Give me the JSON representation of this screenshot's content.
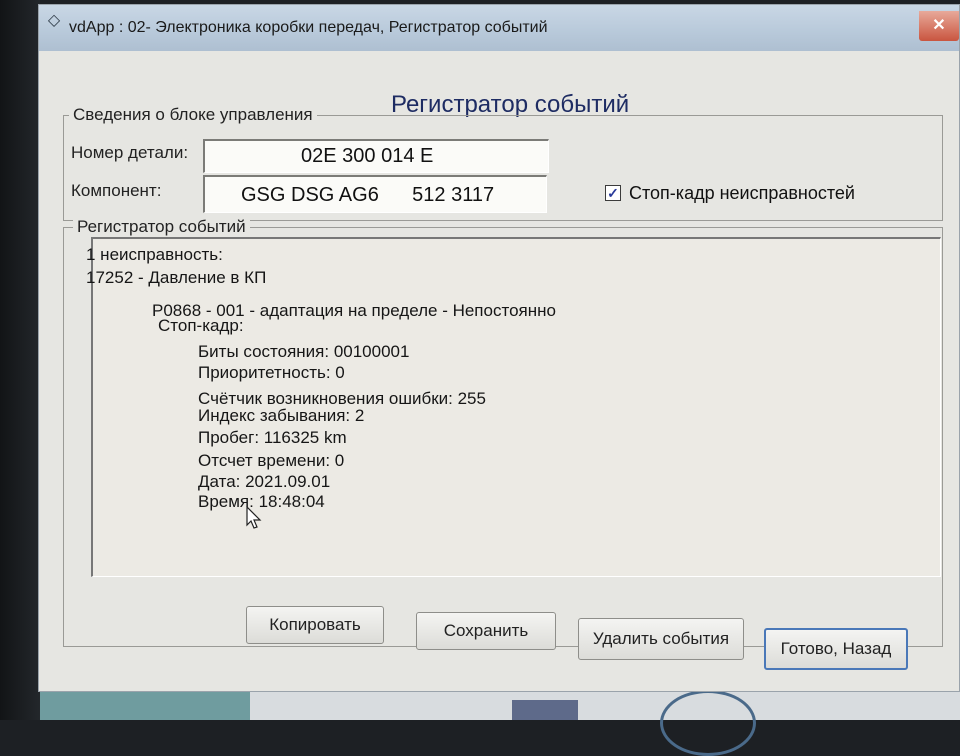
{
  "window": {
    "title": "vdApp : 02- Электроника коробки передач,  Регистратор событий",
    "close_glyph": "✕",
    "app_icon_glyph": "◇"
  },
  "dialog": {
    "title": "Регистратор событий"
  },
  "control_unit": {
    "legend": "Сведения о блоке управления",
    "part_number_label": "Номер детали:",
    "part_number_value": "02E 300 014 E",
    "component_label": "Компонент:",
    "component_value": "GSG DSG AG6      512 3117",
    "freeze_frame_checkbox_label": "Стоп-кадр неисправностей",
    "freeze_frame_checked": true
  },
  "event_log": {
    "legend": "Регистратор событий",
    "lines": [
      "1 неисправность:",
      "17252 - Давление в КП",
      "P0868 - 001 - адаптация на пределе - Непостоянно",
      "Стоп-кадр:",
      "Биты состояния: 00100001",
      "Приоритетность: 0",
      "Счётчик возникновения ошибки: 255",
      "Индекс забывания: 2",
      "Пробег: 116325 km",
      "Отсчет времени: 0",
      "Дата: 2021.09.01",
      "Время: 18:48:04"
    ]
  },
  "buttons": {
    "copy": "Копировать",
    "save": "Сохранить",
    "delete_events": "Удалить события",
    "done_back": "Готово, Назад"
  },
  "colors": {
    "titlebar": "#b8c9da",
    "dialog_title": "#1e2c63",
    "window_bg": "#e6e6e2",
    "close_button": "#c9553f"
  }
}
